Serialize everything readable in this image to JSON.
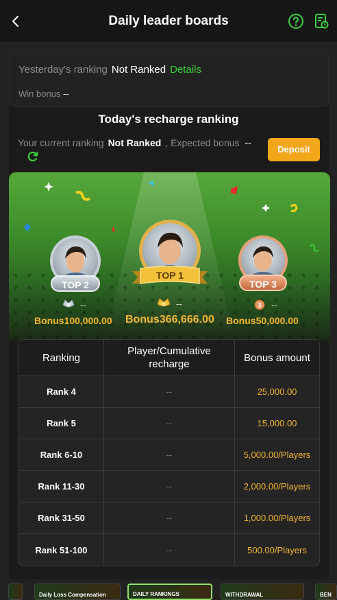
{
  "header": {
    "title": "Daily leader boards",
    "back_icon": "chevron-left-icon",
    "help_icon": "question-circle-icon",
    "records_icon": "document-clock-icon",
    "accent": "#3bd13b"
  },
  "yesterday": {
    "label": "Yesterday's ranking",
    "value": "Not Ranked",
    "details_link": "Details",
    "win_bonus_label": "Win bonus",
    "win_bonus_value": "--"
  },
  "today": {
    "title": "Today's recharge ranking",
    "current_label": "Your current ranking",
    "current_value": "Not Ranked",
    "expected_label": ", Expected bonus",
    "expected_value": "--",
    "deposit_button": "Deposit",
    "refresh_icon": "refresh-icon"
  },
  "podium": {
    "top1": {
      "badge": "TOP 1",
      "player": "--",
      "bonus_label": "Bonus",
      "bonus_value": "366,666.00"
    },
    "top2": {
      "badge": "TOP 2",
      "player": "--",
      "bonus_label": "Bonus",
      "bonus_value": "100,000.00"
    },
    "top3": {
      "badge": "TOP 3",
      "player": "--",
      "bonus_label": "Bonus",
      "bonus_value": "50,000.00"
    }
  },
  "table": {
    "headers": [
      "Ranking",
      "Player/Cumulative recharge",
      "Bonus amount"
    ],
    "rows": [
      {
        "rank": "Rank 4",
        "player": "--",
        "bonus": "25,000.00"
      },
      {
        "rank": "Rank 5",
        "player": "--",
        "bonus": "15,000.00"
      },
      {
        "rank": "Rank 6-10",
        "player": "--",
        "bonus": "5,000.00/Players"
      },
      {
        "rank": "Rank 11-30",
        "player": "--",
        "bonus": "2,000.00/Players"
      },
      {
        "rank": "Rank 31-50",
        "player": "--",
        "bonus": "1,000.00/Players"
      },
      {
        "rank": "Rank 51-100",
        "player": "--",
        "bonus": "500.00/Players"
      }
    ]
  },
  "banners": [
    {
      "label": ""
    },
    {
      "label": "Daily Loss Compensation"
    },
    {
      "label": "DAILY RANKINGS"
    },
    {
      "label": "WITHDRAWAL"
    },
    {
      "label": "BEN"
    }
  ]
}
